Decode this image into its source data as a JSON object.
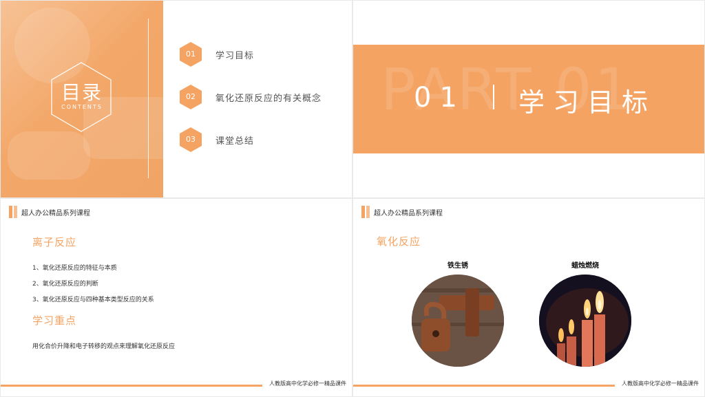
{
  "slide1": {
    "title": "目录",
    "subtitle": "CONTENTS",
    "items": [
      {
        "num": "01",
        "label": "学习目标"
      },
      {
        "num": "02",
        "label": "氧化还原反应的有关概念"
      },
      {
        "num": "03",
        "label": "课堂总结"
      }
    ]
  },
  "slide2": {
    "ghost": "PART 01",
    "num": "01",
    "title": "学习目标"
  },
  "slide3": {
    "brand": "超人办公精品系列课程",
    "section1": "离子反应",
    "items": [
      "1、氧化还原反应的特征与本质",
      "2、氧化还原反应的判断",
      "3、氧化还原反应与四种基本类型反应的关系"
    ],
    "section2": "学习重点",
    "focus": "用化合价升降和电子转移的观点来理解氧化还原反应",
    "footer": "人教版高中化学必修一精品课件"
  },
  "slide4": {
    "brand": "超人办公精品系列课程",
    "section": "氧化反应",
    "caption_left": "铁生锈",
    "caption_right": "蜡烛燃烧",
    "footer": "人教版高中化学必修一精品课件"
  },
  "colors": {
    "accent": "#f4a362",
    "text": "#333333"
  }
}
